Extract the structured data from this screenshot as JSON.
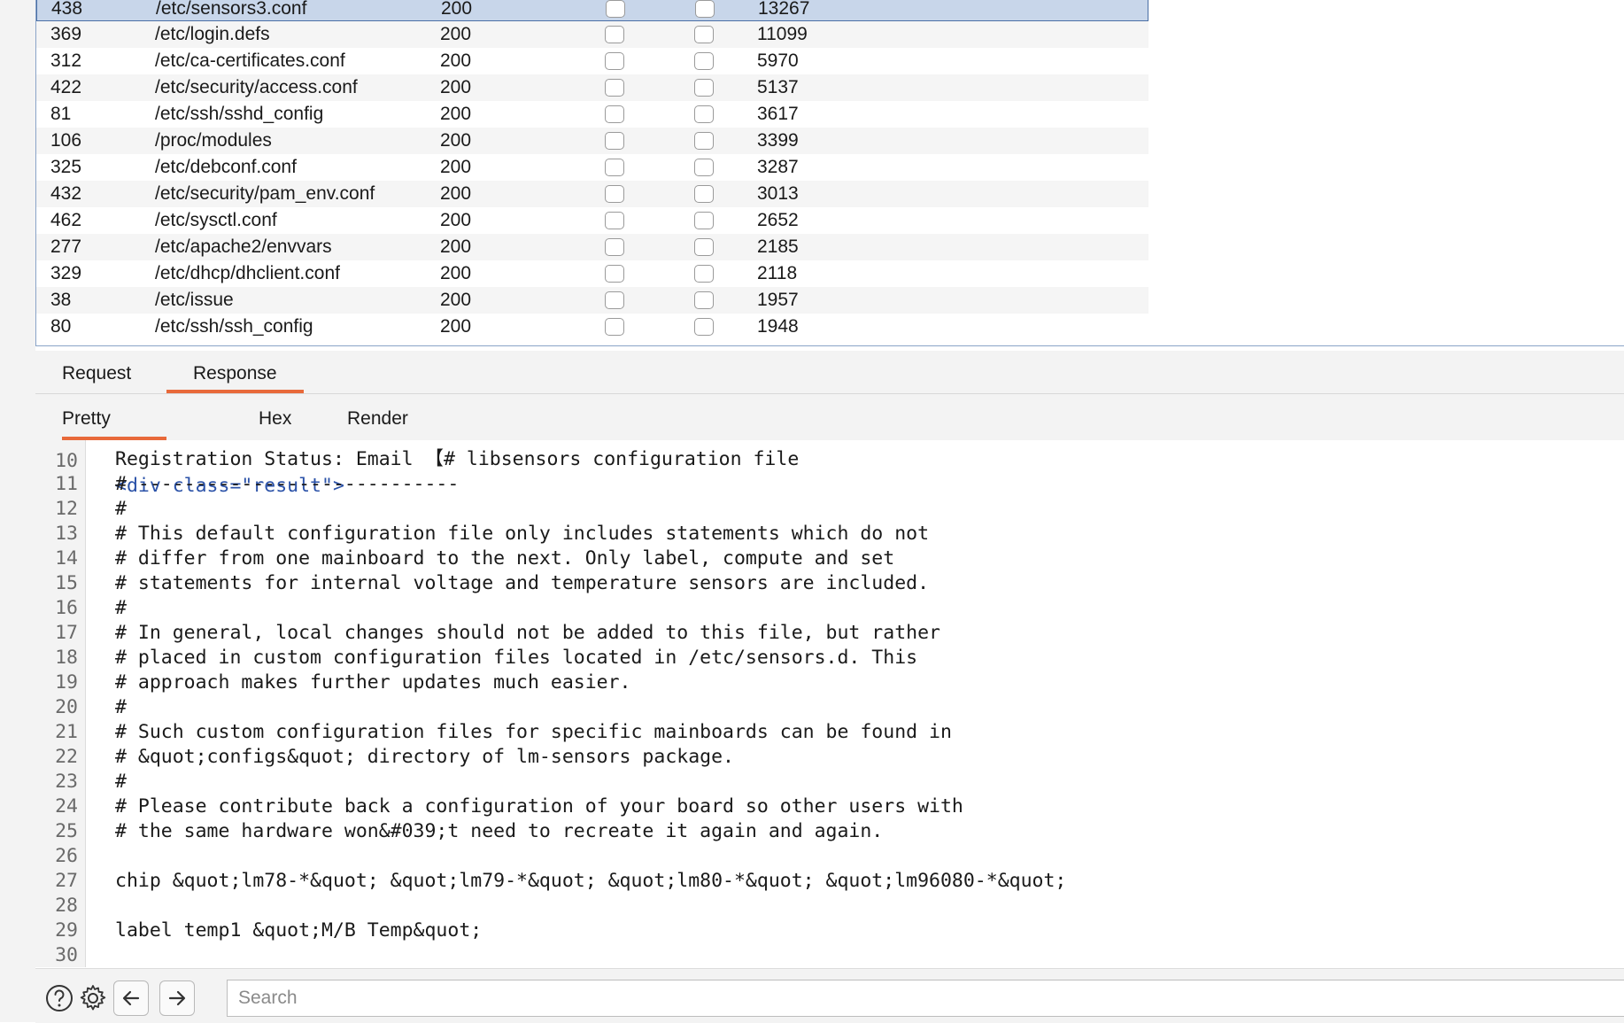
{
  "table": {
    "rows": [
      {
        "id": "438",
        "path": "/etc/sensors3.conf",
        "status": "200",
        "length": "13267",
        "selected": true
      },
      {
        "id": "369",
        "path": "/etc/login.defs",
        "status": "200",
        "length": "11099"
      },
      {
        "id": "312",
        "path": "/etc/ca-certificates.conf",
        "status": "200",
        "length": "5970"
      },
      {
        "id": "422",
        "path": "/etc/security/access.conf",
        "status": "200",
        "length": "5137"
      },
      {
        "id": "81",
        "path": "/etc/ssh/sshd_config",
        "status": "200",
        "length": "3617"
      },
      {
        "id": "106",
        "path": "/proc/modules",
        "status": "200",
        "length": "3399"
      },
      {
        "id": "325",
        "path": "/etc/debconf.conf",
        "status": "200",
        "length": "3287"
      },
      {
        "id": "432",
        "path": "/etc/security/pam_env.conf",
        "status": "200",
        "length": "3013"
      },
      {
        "id": "462",
        "path": "/etc/sysctl.conf",
        "status": "200",
        "length": "2652"
      },
      {
        "id": "277",
        "path": "/etc/apache2/envvars",
        "status": "200",
        "length": "2185"
      },
      {
        "id": "329",
        "path": "/etc/dhcp/dhclient.conf",
        "status": "200",
        "length": "2118"
      },
      {
        "id": "38",
        "path": "/etc/issue",
        "status": "200",
        "length": "1957"
      },
      {
        "id": "80",
        "path": "/etc/ssh/ssh_config",
        "status": "200",
        "length": "1948"
      }
    ]
  },
  "tabs": {
    "request": "Request",
    "response": "Response"
  },
  "subtabs": {
    "pretty": "Pretty",
    "hex": "Hex",
    "render": "Render"
  },
  "editor": {
    "clipped_top": "<div class=\"result\">",
    "lines": [
      {
        "n": "",
        "text": "Registration Status: Email 【# libsensors configuration file"
      },
      {
        "n": "11",
        "text": "# ----------------------------"
      },
      {
        "n": "12",
        "text": "#"
      },
      {
        "n": "13",
        "text": "# This default configuration file only includes statements which do not"
      },
      {
        "n": "14",
        "text": "# differ from one mainboard to the next. Only label, compute and set"
      },
      {
        "n": "15",
        "text": "# statements for internal voltage and temperature sensors are included."
      },
      {
        "n": "16",
        "text": "#"
      },
      {
        "n": "17",
        "text": "# In general, local changes should not be added to this file, but rather"
      },
      {
        "n": "18",
        "text": "# placed in custom configuration files located in /etc/sensors.d. This"
      },
      {
        "n": "19",
        "text": "# approach makes further updates much easier."
      },
      {
        "n": "20",
        "text": "#"
      },
      {
        "n": "21",
        "text": "# Such custom configuration files for specific mainboards can be found in"
      },
      {
        "n": "22",
        "text": "# &quot;configs&quot; directory of lm-sensors package."
      },
      {
        "n": "23",
        "text": "#"
      },
      {
        "n": "24",
        "text": "# Please contribute back a configuration of your board so other users with"
      },
      {
        "n": "25",
        "text": "# the same hardware won&#039;t need to recreate it again and again."
      },
      {
        "n": "26",
        "text": ""
      },
      {
        "n": "27",
        "text": "chip &quot;lm78-*&quot; &quot;lm79-*&quot; &quot;lm80-*&quot; &quot;lm96080-*&quot;"
      },
      {
        "n": "28",
        "text": ""
      },
      {
        "n": "29",
        "text": "label temp1 &quot;M/B Temp&quot;"
      },
      {
        "n": "30",
        "text": ""
      }
    ]
  },
  "bottom": {
    "search_placeholder": "Search"
  }
}
